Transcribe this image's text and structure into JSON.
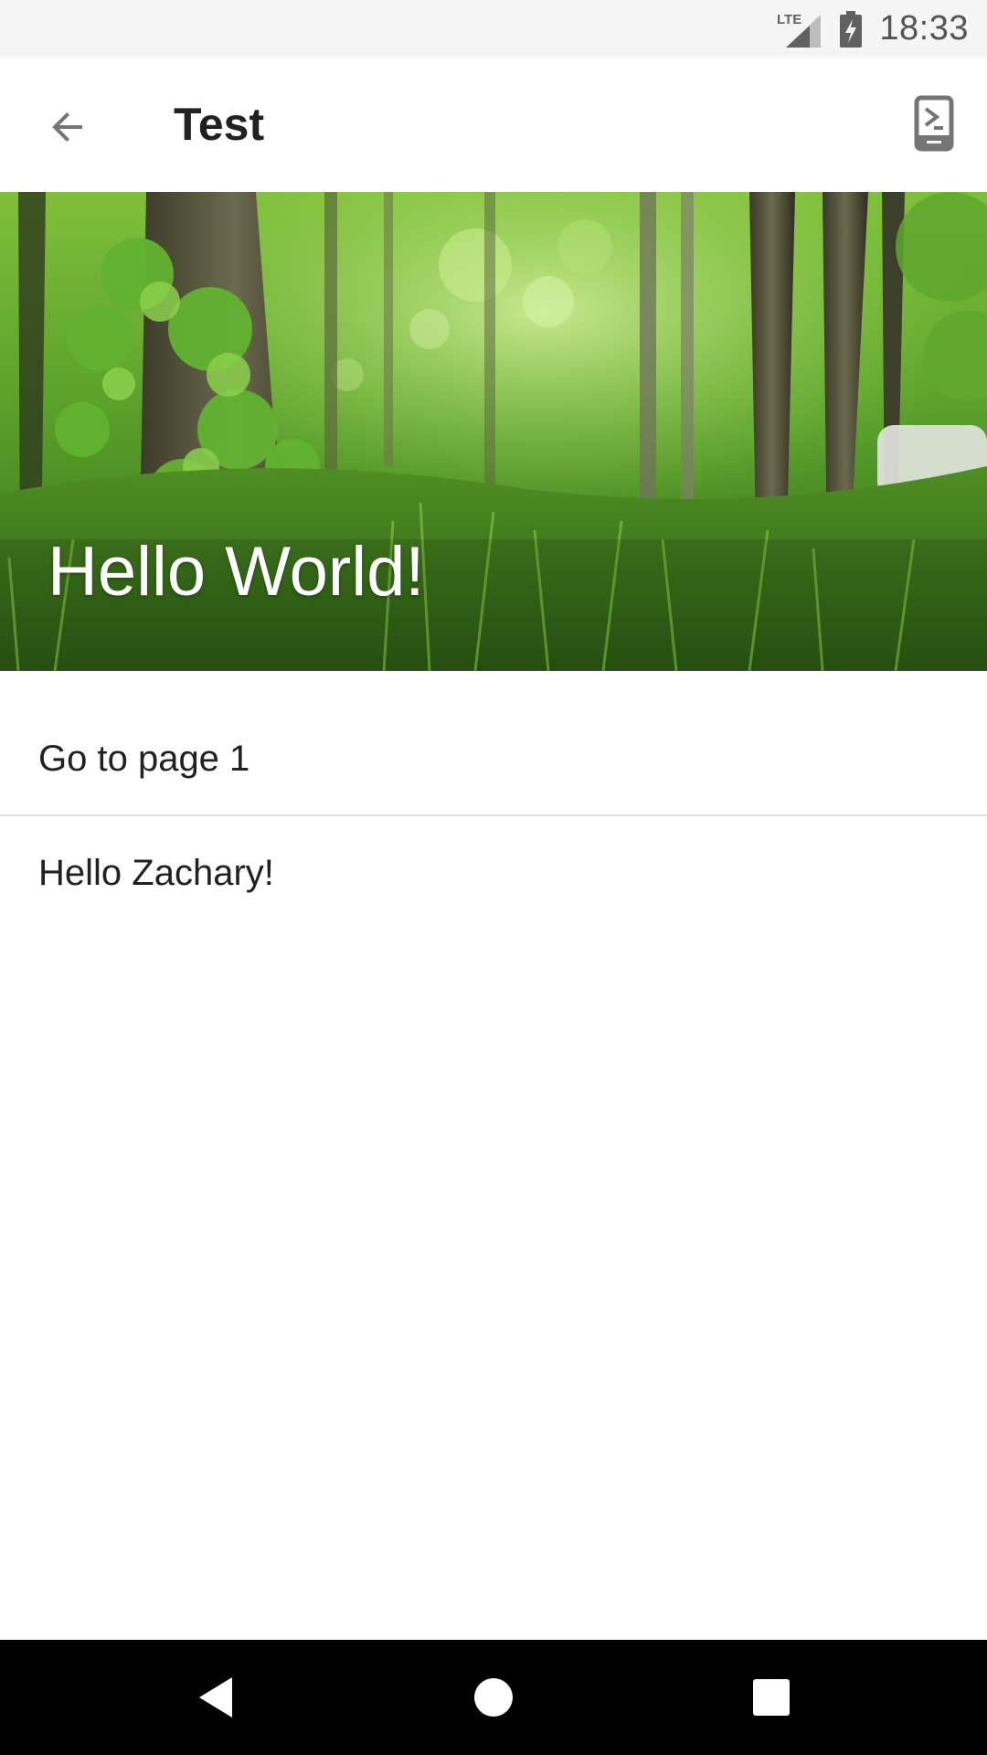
{
  "status_bar": {
    "network_label": "LTE",
    "time": "18:33"
  },
  "toolbar": {
    "title": "Test",
    "back_icon": "arrow-back-icon",
    "action_icon": "phone-console-icon"
  },
  "hero": {
    "title": "Hello World!",
    "image": "forest-photo"
  },
  "list": {
    "items": [
      {
        "label": "Go to page 1",
        "clickable": true
      },
      {
        "label": "Hello Zachary!",
        "clickable": false
      }
    ]
  },
  "nav_bar": {
    "back_icon": "nav-back-icon",
    "home_icon": "nav-home-icon",
    "recents_icon": "nav-recents-icon"
  },
  "colors": {
    "status_bar_bg": "#f5f5f5",
    "text_primary": "#212121",
    "icon_gray": "#757575",
    "divider": "#e0e0e0",
    "nav_bar_bg": "#000000"
  }
}
